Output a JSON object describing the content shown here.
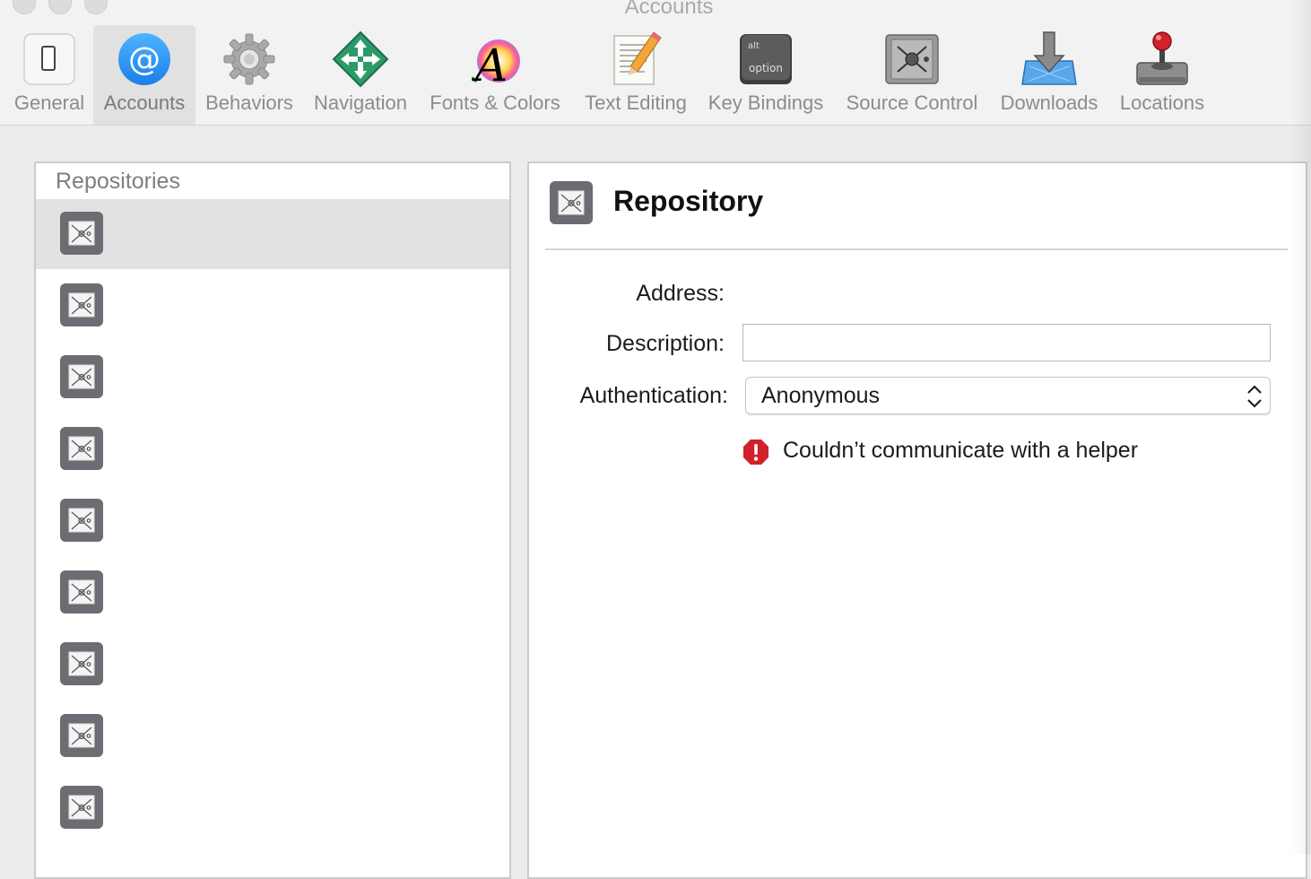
{
  "window": {
    "title": "Accounts"
  },
  "toolbar": {
    "items": [
      {
        "label": "General",
        "icon": "general-icon"
      },
      {
        "label": "Accounts",
        "icon": "accounts-at-icon",
        "selected": true
      },
      {
        "label": "Behaviors",
        "icon": "gear-icon"
      },
      {
        "label": "Navigation",
        "icon": "navigation-arrows-icon"
      },
      {
        "label": "Fonts & Colors",
        "icon": "fonts-colors-icon"
      },
      {
        "label": "Text Editing",
        "icon": "text-editing-icon"
      },
      {
        "label": "Key Bindings",
        "icon": "option-key-icon"
      },
      {
        "label": "Source Control",
        "icon": "source-control-safe-icon"
      },
      {
        "label": "Downloads",
        "icon": "downloads-icon"
      },
      {
        "label": "Locations",
        "icon": "locations-joystick-icon"
      }
    ],
    "key_bindings_keycap": {
      "top": "alt",
      "bottom": "option"
    }
  },
  "repositories": {
    "header": "Repositories",
    "row_count": 9,
    "selected_index": 0,
    "row_icon": "repository-icon"
  },
  "detail": {
    "title": "Repository",
    "icon": "repository-icon",
    "address_label": "Address:",
    "address_value": "",
    "description_label": "Description:",
    "description_value": "",
    "authentication_label": "Authentication:",
    "authentication_value": "Anonymous",
    "error_message": "Couldn’t communicate with a helper",
    "error_color": "#d0202a"
  }
}
